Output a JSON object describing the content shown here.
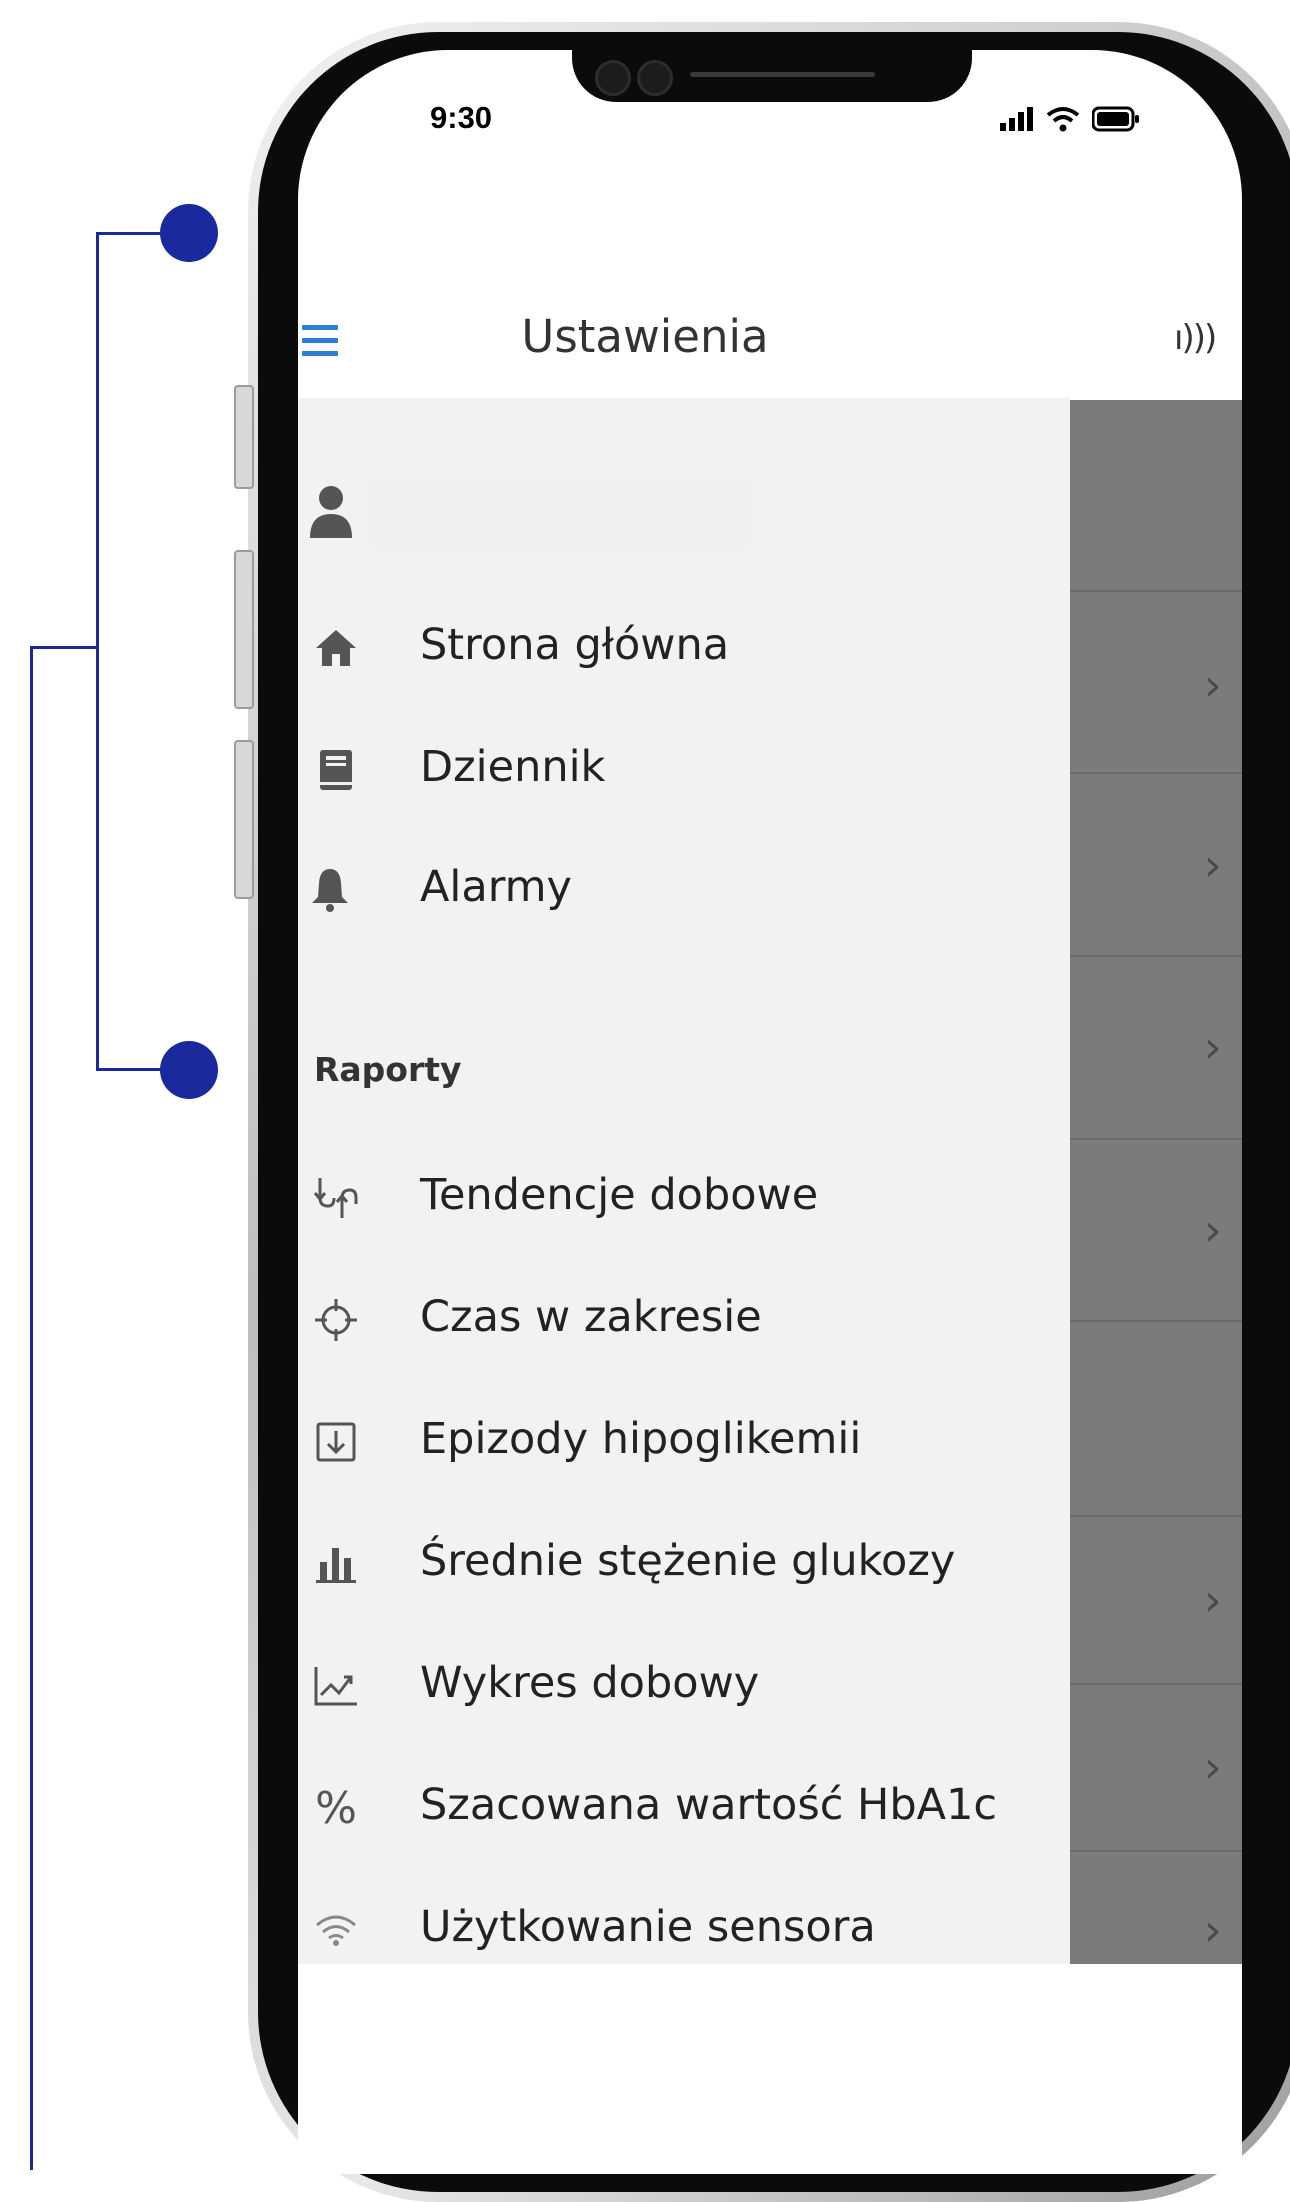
{
  "status_bar": {
    "time": "9:30"
  },
  "header": {
    "title": "Ustawienia",
    "menu_icon": "hamburger-icon",
    "nfc_icon": "nfc-icon"
  },
  "drawer": {
    "user_icon": "user-icon",
    "main_items": [
      {
        "icon": "home-icon",
        "label": "Strona główna"
      },
      {
        "icon": "book-icon",
        "label": "Dziennik"
      },
      {
        "icon": "bell-icon",
        "label": "Alarmy"
      }
    ],
    "section_title": "Raporty",
    "report_items": [
      {
        "icon": "trend-icon",
        "label": "Tendencje dobowe"
      },
      {
        "icon": "target-icon",
        "label": "Czas w zakresie"
      },
      {
        "icon": "down-box-icon",
        "label": "Epizody hipoglikemii"
      },
      {
        "icon": "bar-chart-icon",
        "label": "Średnie stężenie glukozy"
      },
      {
        "icon": "line-chart-icon",
        "label": "Wykres dobowy"
      },
      {
        "icon": "percent-icon",
        "label": "Szacowana wartość HbA1c"
      },
      {
        "icon": "wifi-icon",
        "label": "Użytkowanie sensora"
      }
    ]
  },
  "colors": {
    "accent": "#2f7dd6",
    "callout": "#1a2a9c",
    "drawer_bg": "#f2f2f2",
    "underlay_bg": "#7b7b7b"
  }
}
